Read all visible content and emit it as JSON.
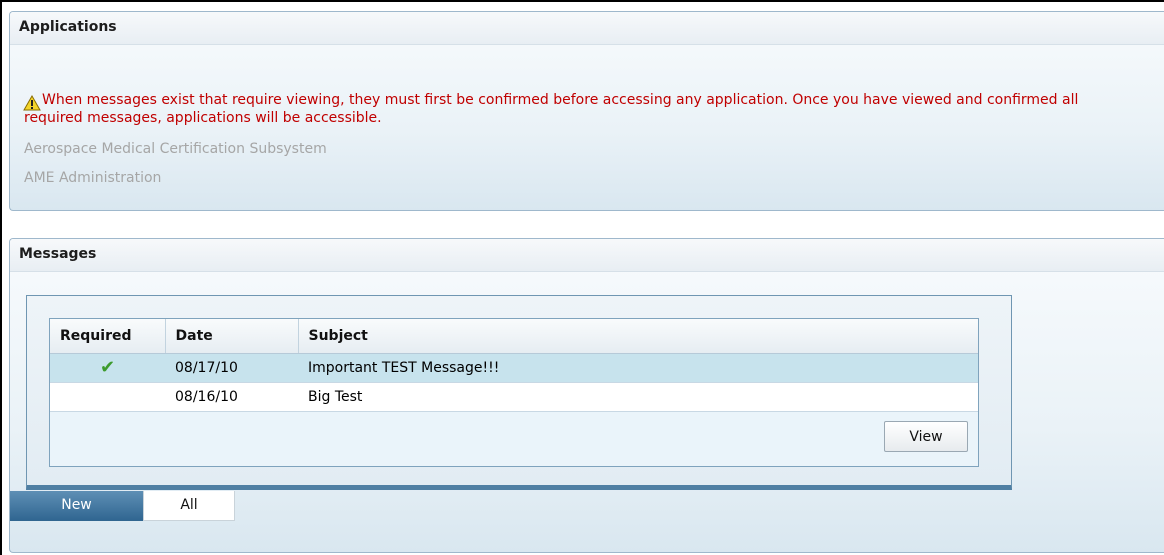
{
  "applications": {
    "title": "Applications",
    "notice_icon": "warning-icon",
    "notice": "When messages exist that require viewing, they must first be confirmed before accessing any application. Once you have viewed and confirmed all required messages, applications will be accessible.",
    "links": [
      {
        "label": "Aerospace Medical Certification Subsystem"
      },
      {
        "label": "AME Administration"
      }
    ]
  },
  "messages": {
    "title": "Messages",
    "columns": {
      "required": "Required",
      "date": "Date",
      "subject": "Subject"
    },
    "rows": [
      {
        "required": true,
        "required_icon": "check-icon",
        "date": "08/17/10",
        "subject": "Important TEST Message!!!",
        "selected": true
      },
      {
        "required": false,
        "date": "08/16/10",
        "subject": "Big Test",
        "selected": false
      }
    ],
    "view_label": "View",
    "tabs": [
      {
        "label": "New",
        "active": true
      },
      {
        "label": "All",
        "active": false
      }
    ]
  },
  "colors": {
    "notice_text": "#c00000",
    "disabled_link": "#a6a6a6",
    "selected_row": "#c7e3ed",
    "active_tab": "#2f6590",
    "check": "#3d9b2e"
  }
}
